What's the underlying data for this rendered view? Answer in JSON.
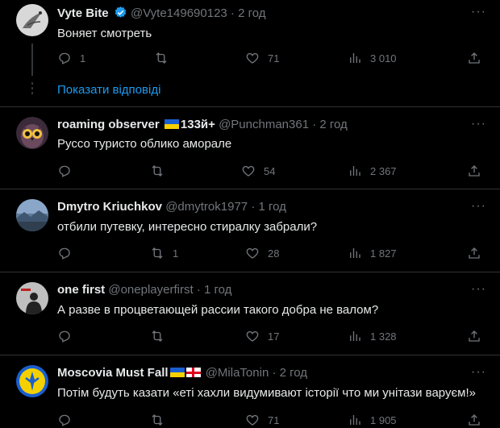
{
  "show_replies_label": "Показати відповіді",
  "tweets": [
    {
      "name": "Vyte Bite",
      "handle": "@Vyte149690123",
      "time": "2 год",
      "text": "Воняет смотреть",
      "replies": "1",
      "retweets": "",
      "likes": "71",
      "views": "3 010",
      "avatar": "egret-bird"
    },
    {
      "name": "roaming observer",
      "name_suffix": "133й+",
      "handle": "@Punchman361",
      "time": "2 год",
      "text": "Руссо туристо облико аморале",
      "replies": "",
      "retweets": "",
      "likes": "54",
      "views": "2 367",
      "avatar": "owl"
    },
    {
      "name": "Dmytro Kriuchkov",
      "handle": "@dmytrok1977",
      "time": "1 год",
      "text": "отбили путевку, интересно стиралку забрали?",
      "replies": "",
      "retweets": "1",
      "likes": "28",
      "views": "1 827",
      "avatar": "landscape"
    },
    {
      "name": "one first",
      "handle": "@oneplayerfirst",
      "time": "1 год",
      "text": "А разве в процветающей рассии такого добра не валом?",
      "replies": "",
      "retweets": "",
      "likes": "17",
      "views": "1 328",
      "avatar": "person-silhouette"
    },
    {
      "name": "Moscovia Must Fall",
      "handle": "@MilaTonin",
      "time": "2 год",
      "text": "Потім будуть казати «еті хахли видумивают історії что ми унітази варуєм!»",
      "replies": "",
      "retweets": "",
      "likes": "71",
      "views": "1 905",
      "avatar": "yellow-emblem"
    }
  ],
  "colors": {
    "background": "#000000",
    "text": "#e7e9ea",
    "muted": "#71767b",
    "link": "#1d9bf0",
    "verified": "#1d9bf0",
    "divider": "#2f3336"
  }
}
